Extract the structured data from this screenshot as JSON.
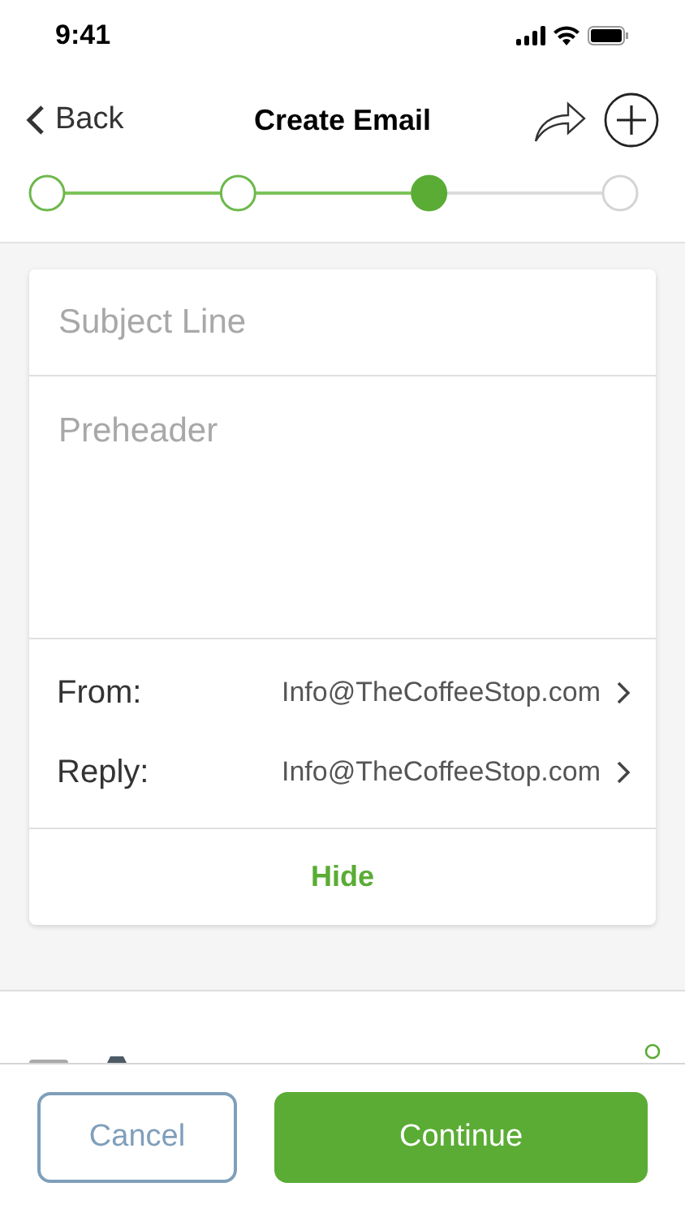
{
  "status_bar": {
    "time": "9:41"
  },
  "nav": {
    "back": "Back",
    "title": "Create Email"
  },
  "steps": [
    {
      "completed": true,
      "selected": false
    },
    {
      "completed": true,
      "selected": false
    },
    {
      "completed": true,
      "selected": true
    },
    {
      "completed": false,
      "selected": false
    }
  ],
  "form": {
    "subject": {
      "placeholder": "Subject Line"
    },
    "preheader": {
      "placeholder": "Preheader"
    },
    "senders": [
      {
        "label": "From:",
        "value": "Info@TheCoffeeStop.com"
      },
      {
        "label": "Reply:",
        "value": "Info@TheCoffeeStop.com"
      }
    ],
    "toggle": "Hide"
  },
  "footer": {
    "cancel": "Cancel",
    "continue": "Continue"
  }
}
